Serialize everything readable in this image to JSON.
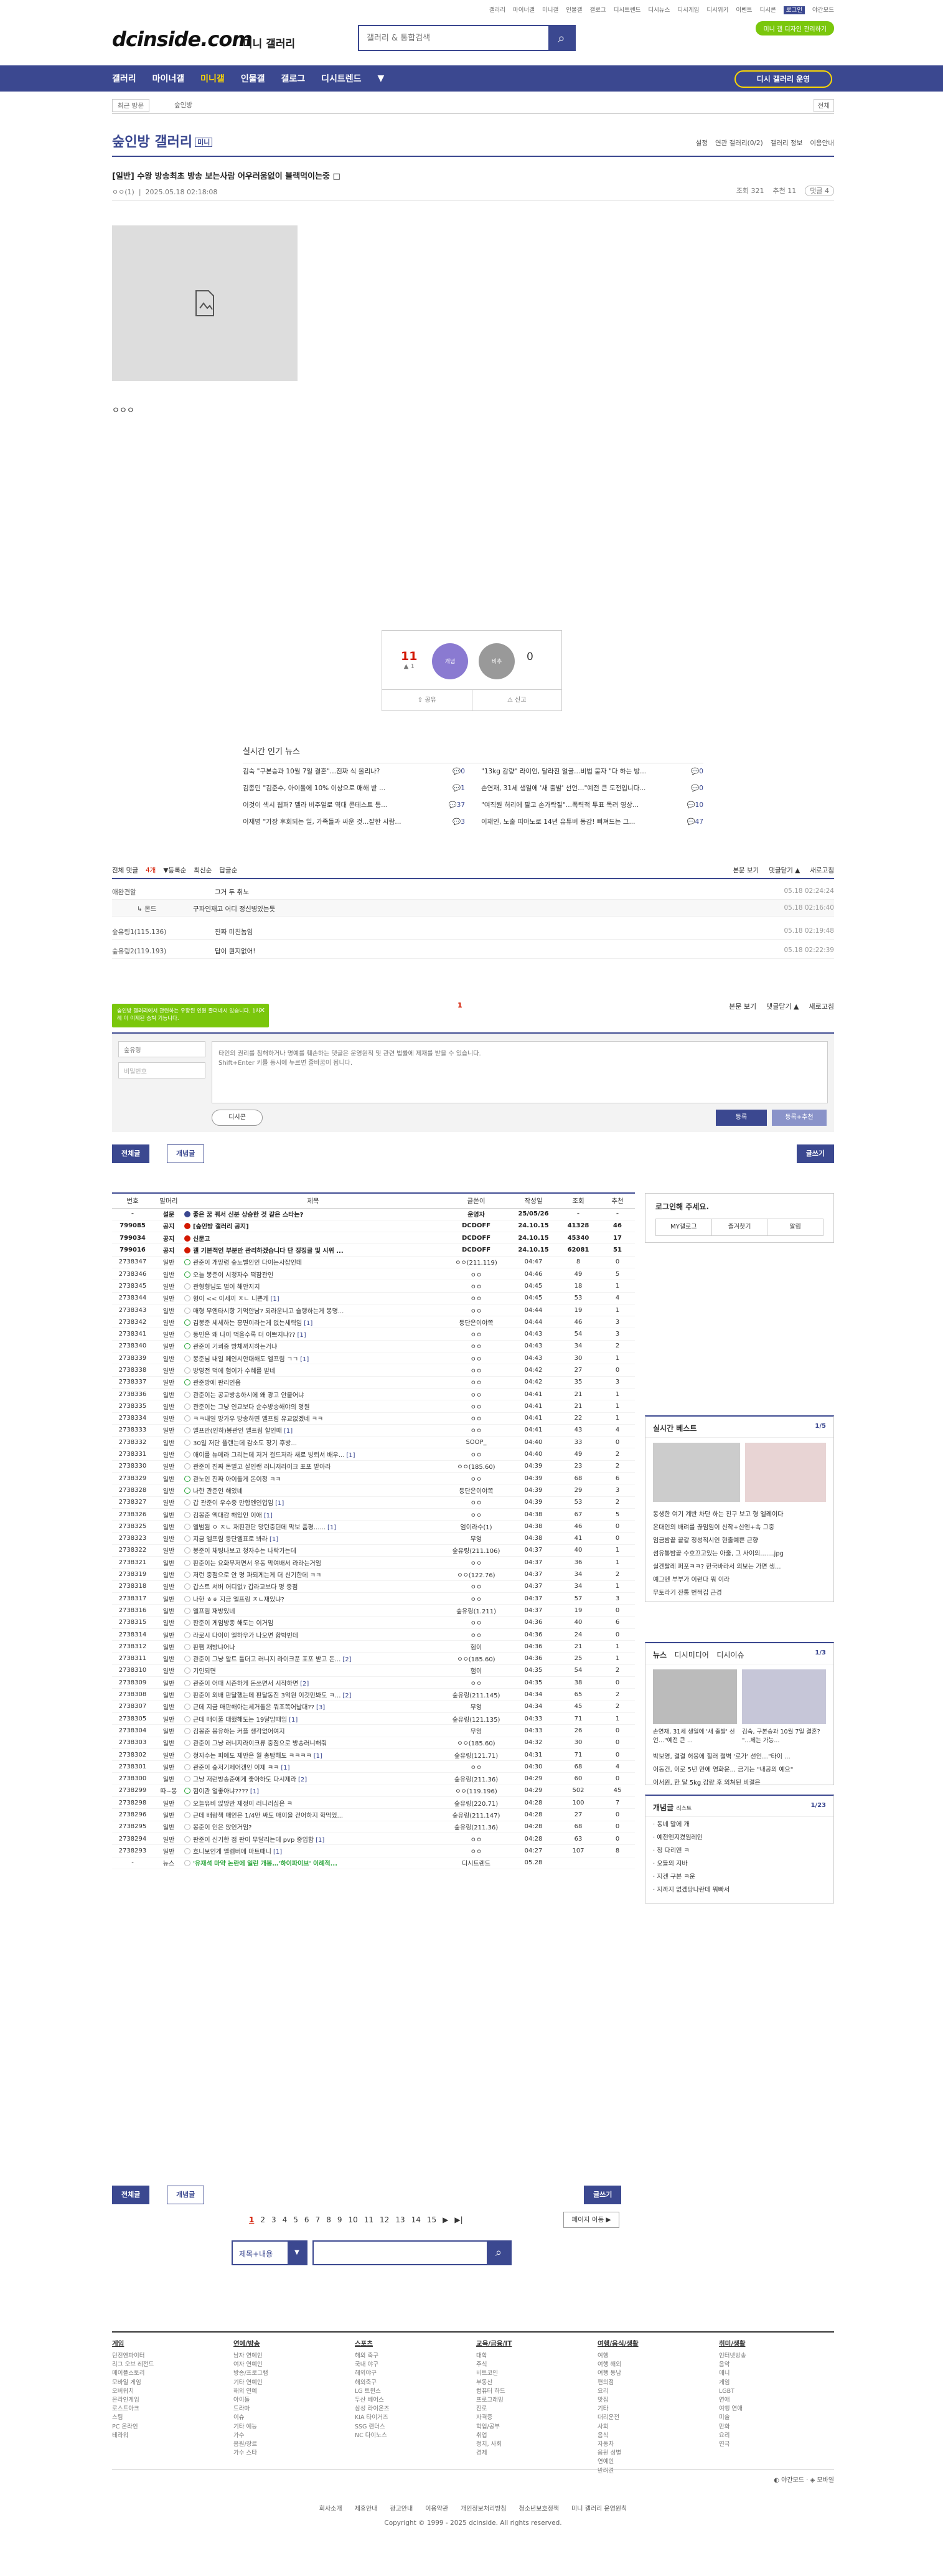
{
  "topbar": {
    "links": [
      "갤러리",
      "마이너갤",
      "미니갤",
      "인물갤",
      "갤로그",
      "디시트렌드",
      "디시뉴스",
      "디시게임",
      "디시위키",
      "이벤트",
      "디시콘",
      "로그인",
      "야간모드"
    ]
  },
  "header": {
    "logo": "dcinside.com",
    "logo_sub": "미니 갤러리",
    "search_placeholder": "갤러리 & 통합검색",
    "mini_btn": "미니 갤 디자인 관리하기"
  },
  "gnb": {
    "items": [
      "갤러리",
      "마이너갤",
      "미니갤",
      "인물갤",
      "갤로그",
      "디시트렌드",
      "▼"
    ],
    "active": "미니갤",
    "cta": "디시 갤러리 운영"
  },
  "crumb": {
    "recent": "최근 방문",
    "gallery": "숲인방",
    "all": "전체"
  },
  "gallery": {
    "title": "숲인방 갤러리",
    "badge": "미니",
    "right": [
      "설정",
      "연관 갤러리(0/2)",
      "갤러리 정보",
      "이용안내"
    ]
  },
  "post": {
    "title": "[일반] 수왕 방송최초 방송 보는사람 어우러움없이 블랙먹이는중",
    "writer": "ㅇㅇ(1)",
    "date": "2025.05.18 02:18:08",
    "views": "조회 321",
    "recs": "추천 11",
    "comments": "댓글 4",
    "body": "ㅇㅇㅇ"
  },
  "vote": {
    "up": "11",
    "up_sub": "▲ 1",
    "up_label": "개념",
    "down": "0",
    "down_label": "비추",
    "share": "공유",
    "report": "신고"
  },
  "news": {
    "title": "실시간 인기 뉴스",
    "items": [
      {
        "t": "김숙 \"구본승과 10월 7일 결혼\"…진짜 식 올리나?",
        "n": "0"
      },
      {
        "t": "\"13kg 감량\" 라이언, 달라진 얼굴…비법 묻자 \"다 하는 방...",
        "n": "0"
      },
      {
        "t": "김종민 \"김준수, 아이돌에 10% 이상으로 매해 받 ...",
        "n": "1"
      },
      {
        "t": "손연재, 31세 생일에 '새 출발' 선언…\"예전 큰 도전입니다...",
        "n": "0"
      },
      {
        "t": "이것이 섹시 웹퍼? 멜라 비주얼로 역대 콘테스트 등...",
        "n": "37"
      },
      {
        "t": "\"여직원 허리에 팔고 손가락질\"…폭력적 투표 독려 영상...",
        "n": "10"
      },
      {
        "t": "이재명 \"가장 후회되는 일, 가족들과 싸운 것...잘한 사람...",
        "n": "3"
      },
      {
        "t": "이재인, 노출 피아노로 14년 유튜버 동감! 빠져드는 그...",
        "n": "47"
      }
    ]
  },
  "comments_bar": {
    "left": [
      "전체 댓글",
      "4개",
      "▼등록순",
      "최신순",
      "답글순"
    ],
    "right": [
      "본문 보기",
      "댓글닫기 ▲",
      "새로고침"
    ]
  },
  "comment_rows": [
    {
      "n": "애완견알",
      "m": "그거 두 취노",
      "d": "05.18 02:24:24",
      "sub": false
    },
    {
      "n": "몬드",
      "m": "구파인재고 어디 정신병있는듯",
      "d": "05.18 02:16:40",
      "sub": true
    },
    {
      "n": "숲유링1(115.136)",
      "m": "진짜 미친놈임",
      "d": "05.18 02:19:48",
      "sub": false
    },
    {
      "n": "숲유링2(119.193)",
      "m": "답이 뭔지없어!",
      "d": "05.18 02:22:39",
      "sub": false
    }
  ],
  "page_indicator": "1",
  "tip": "숲인방 갤러리에서 관련하는 우항된 인원 졸더네시 있습니다. 1차례 이 이제된 숨쳐 기능니다.",
  "form": {
    "nick": "숲유링",
    "pw_placeholder": "비밀번호",
    "text_placeholder": "타인의 권리를 침해하거나 명예를 훼손하는 댓글은 운영원칙 및 관련 법률에 제재를 받을 수 있습니다.\nShift+Enter 키를 동시에 누르면 줄바꿈이 됩니다.",
    "dccon": "디시콘",
    "submit": "등록",
    "submit2": "등록+추천"
  },
  "tabs": {
    "all": "전체글",
    "best": "개념글",
    "write": "글쓰기"
  },
  "list": {
    "headers": [
      "번호",
      "말머리",
      "제목",
      "글쓴이",
      "작성일",
      "조회",
      "추천"
    ],
    "rows": [
      {
        "no": "-",
        "h": "설문",
        "t": "좋은 꿈 꿔서 신분 상승한 것 같은 스타는?",
        "c": "",
        "w": "운영자",
        "d": "25/05/26",
        "v": "-",
        "r": "-",
        "nt": 1,
        "ic": "blue"
      },
      {
        "no": "799085",
        "h": "공지",
        "t": "[숲인방 갤러리 공지]",
        "c": "",
        "w": "DCDOFF",
        "d": "24.10.15",
        "v": "41328",
        "r": "46",
        "nt": 1,
        "ic": "red"
      },
      {
        "no": "799034",
        "h": "공지",
        "t": "신문고",
        "c": "",
        "w": "DCDOFF",
        "d": "24.10.15",
        "v": "45340",
        "r": "17",
        "nt": 1,
        "ic": "red"
      },
      {
        "no": "799016",
        "h": "공지",
        "t": "갤 기본적인 부분만 관리하겠습니다 단 징징글 및 시위 ...",
        "c": "",
        "w": "DCDOFF",
        "d": "24.10.15",
        "v": "62081",
        "r": "51",
        "nt": 1,
        "ic": "red"
      },
      {
        "no": "2738347",
        "h": "일반",
        "t": "관준이 개망령 숲노벨인인 다이는사잡인데",
        "c": "",
        "w": "ㅇㅇ(211.119)",
        "d": "04:47",
        "v": "8",
        "r": "0",
        "nt": 0,
        "ic": "green"
      },
      {
        "no": "2738346",
        "h": "일반",
        "t": "오늘 봉준이 시청자수 떡잠관인",
        "c": "",
        "w": "ㅇㅇ",
        "d": "04:46",
        "v": "49",
        "r": "5",
        "nt": 0,
        "ic": "green"
      },
      {
        "no": "2738345",
        "h": "일반",
        "t": "관형형님도 벌이 해안지지",
        "c": "",
        "w": "ㅇㅇ",
        "d": "04:45",
        "v": "18",
        "r": "1",
        "nt": 0,
        "ic": ""
      },
      {
        "no": "2738344",
        "h": "일반",
        "t": "형이 << 이세끼 ㅈㄴ 니쁜게",
        "c": "[1]",
        "w": "ㅇㅇ",
        "d": "04:45",
        "v": "53",
        "r": "4",
        "nt": 0,
        "ic": ""
      },
      {
        "no": "2738343",
        "h": "일반",
        "t": "매형 무엔타시항 기억안남? 되라운니고 슬랭하는게 봉명...",
        "c": "",
        "w": "ㅇㅇ",
        "d": "04:44",
        "v": "19",
        "r": "1",
        "nt": 0,
        "ic": ""
      },
      {
        "no": "2738342",
        "h": "일반",
        "t": "김봉준 세세하는 흥면이라는게 없는세력임",
        "c": "[1]",
        "w": "등단은이야쪽",
        "d": "04:44",
        "v": "46",
        "r": "3",
        "nt": 0,
        "ic": "green"
      },
      {
        "no": "2738341",
        "h": "일반",
        "t": "동민은 왜 나이 먹을수록 더 이쁘지냐??",
        "c": "[1]",
        "w": "ㅇㅇ",
        "d": "04:43",
        "v": "54",
        "r": "3",
        "nt": 0,
        "ic": ""
      },
      {
        "no": "2738340",
        "h": "일반",
        "t": "관준이 기쾨중 방체까지하는거냐",
        "c": "",
        "w": "ㅇㅇ",
        "d": "04:43",
        "v": "34",
        "r": "2",
        "nt": 0,
        "ic": "green"
      },
      {
        "no": "2738339",
        "h": "일반",
        "t": "봉준님 내일 페인시안대해도 엘프림 ㄱㄱ",
        "c": "[1]",
        "w": "ㅇㅇ",
        "d": "04:43",
        "v": "30",
        "r": "1",
        "nt": 0,
        "ic": ""
      },
      {
        "no": "2738338",
        "h": "일반",
        "t": "방영전 먹에 험이가 수혜를 받네",
        "c": "",
        "w": "ㅇㅇ",
        "d": "04:42",
        "v": "27",
        "r": "0",
        "nt": 0,
        "ic": ""
      },
      {
        "no": "2738337",
        "h": "일반",
        "t": "관준방에 판리인음",
        "c": "",
        "w": "ㅇㅇ",
        "d": "04:42",
        "v": "35",
        "r": "3",
        "nt": 0,
        "ic": "green"
      },
      {
        "no": "2738336",
        "h": "일반",
        "t": "관준이는 공교방송하시에 왜 광고 안붙어냐",
        "c": "",
        "w": "ㅇㅇ",
        "d": "04:41",
        "v": "21",
        "r": "1",
        "nt": 0,
        "ic": ""
      },
      {
        "no": "2738335",
        "h": "일반",
        "t": "관준이는 그냥 인교보다 순수방송해야의 명원",
        "c": "",
        "w": "ㅇㅇ",
        "d": "04:41",
        "v": "21",
        "r": "1",
        "nt": 0,
        "ic": ""
      },
      {
        "no": "2738334",
        "h": "일반",
        "t": "ㅋㅋ내일 망가우 방송하면 엘프림 유교없겠네 ㅋㅋ",
        "c": "",
        "w": "ㅇㅇ",
        "d": "04:41",
        "v": "22",
        "r": "1",
        "nt": 0,
        "ic": ""
      },
      {
        "no": "2738333",
        "h": "일반",
        "t": "엘프만(인하)봉관인 엘프림 할인때",
        "c": "[1]",
        "w": "ㅇㅇ",
        "d": "04:41",
        "v": "43",
        "r": "4",
        "nt": 0,
        "ic": ""
      },
      {
        "no": "2738332",
        "h": "일반",
        "t": "30일 저단 플랜는데 감소도 장기 후방...",
        "c": "",
        "w": "SOOP_",
        "d": "04:40",
        "v": "33",
        "r": "0",
        "nt": 0,
        "ic": ""
      },
      {
        "no": "2738331",
        "h": "일반",
        "t": "애이를 뉴메라 그리는데 저거 걸드저라 새로 빙뢰서 배우...",
        "c": "[1]",
        "w": "ㅇㅇ",
        "d": "04:40",
        "v": "49",
        "r": "2",
        "nt": 0,
        "ic": ""
      },
      {
        "no": "2738330",
        "h": "일반",
        "t": "관준이 진짜 돈벌고 살인랜 러니저라이크 포포 받아라",
        "c": "",
        "w": "ㅇㅇ(185.60)",
        "d": "04:39",
        "v": "23",
        "r": "2",
        "nt": 0,
        "ic": ""
      },
      {
        "no": "2738329",
        "h": "일반",
        "t": "관노인 진짜 아이돌게 돈이정 ㅋㅋ",
        "c": "",
        "w": "ㅇㅇ",
        "d": "04:39",
        "v": "68",
        "r": "6",
        "nt": 0,
        "ic": "green"
      },
      {
        "no": "2738328",
        "h": "일반",
        "t": "나한 관준인 해있네",
        "c": "",
        "w": "등단은이야쪽",
        "d": "04:39",
        "v": "29",
        "r": "3",
        "nt": 0,
        "ic": "green"
      },
      {
        "no": "2738327",
        "h": "일반",
        "t": "갑 관준이 우수중 만합엔인업임",
        "c": "[1]",
        "w": "ㅇㅇ",
        "d": "04:39",
        "v": "53",
        "r": "2",
        "nt": 0,
        "ic": ""
      },
      {
        "no": "2738326",
        "h": "일반",
        "t": "김봉준 엑대감 해있인 이애",
        "c": "[1]",
        "w": "ㅇㅇ",
        "d": "04:38",
        "v": "67",
        "r": "5",
        "nt": 0,
        "ic": ""
      },
      {
        "no": "2738325",
        "h": "일반",
        "t": "엘범됨 ㅇ ㅈㄴ 재핀관단 망턴충딘데 막보 품평......",
        "c": "[1]",
        "w": "엄이라수(1)",
        "d": "04:38",
        "v": "46",
        "r": "0",
        "nt": 0,
        "ic": ""
      },
      {
        "no": "2738323",
        "h": "일반",
        "t": "지금 엘프림 등단엘표로 봐라",
        "c": "[1]",
        "w": "무엉",
        "d": "04:38",
        "v": "41",
        "r": "0",
        "nt": 0,
        "ic": ""
      },
      {
        "no": "2738322",
        "h": "일반",
        "t": "봉준이 채팅나보고 청자수는 나락가는데",
        "c": "",
        "w": "숲유링(211.106)",
        "d": "04:37",
        "v": "40",
        "r": "1",
        "nt": 0,
        "ic": ""
      },
      {
        "no": "2738321",
        "h": "일반",
        "t": "판준이는 요화무저면서 유동 막여배서 라라는거임",
        "c": "",
        "w": "ㅇㅇ",
        "d": "04:37",
        "v": "36",
        "r": "1",
        "nt": 0,
        "ic": ""
      },
      {
        "no": "2738319",
        "h": "일반",
        "t": "저런 중점으로 안 명 파되게는게 더 신기한데 ㅋㅋ",
        "c": "",
        "w": "ㅇㅇ(122.76)",
        "d": "04:37",
        "v": "34",
        "r": "2",
        "nt": 0,
        "ic": ""
      },
      {
        "no": "2738318",
        "h": "일반",
        "t": "갑스트 서버 어디없? 갑라교보다 명 중점",
        "c": "",
        "w": "ㅇㅇ",
        "d": "04:37",
        "v": "34",
        "r": "1",
        "nt": 0,
        "ic": ""
      },
      {
        "no": "2738317",
        "h": "일반",
        "t": "나한 ㅎㅎ 지금 엘프링 ㅈㄴ재있냐?",
        "c": "",
        "w": "ㅇㅇ",
        "d": "04:37",
        "v": "57",
        "r": "3",
        "nt": 0,
        "ic": ""
      },
      {
        "no": "2738316",
        "h": "일반",
        "t": "엘프림 재방있네",
        "c": "",
        "w": "숲유링(1.211)",
        "d": "04:37",
        "v": "19",
        "r": "0",
        "nt": 0,
        "ic": ""
      },
      {
        "no": "2738315",
        "h": "일반",
        "t": "판준이 게임방종 해도는 이거임",
        "c": "",
        "w": "ㅇㅇ",
        "d": "04:36",
        "v": "40",
        "r": "6",
        "nt": 0,
        "ic": ""
      },
      {
        "no": "2738314",
        "h": "일반",
        "t": "라로시 다이이 엘하우가 나오면 합박빈데",
        "c": "",
        "w": "ㅇㅇ",
        "d": "04:36",
        "v": "24",
        "r": "0",
        "nt": 0,
        "ic": ""
      },
      {
        "no": "2738312",
        "h": "일반",
        "t": "판팸 재방냐어나",
        "c": "",
        "w": "험이",
        "d": "04:36",
        "v": "21",
        "r": "1",
        "nt": 0,
        "ic": ""
      },
      {
        "no": "2738311",
        "h": "일반",
        "t": "관준이 그냥 알트 틀더고 러니지 라이크푼 포포 받고 돈...",
        "c": "[2]",
        "w": "ㅇㅇ(185.60)",
        "d": "04:36",
        "v": "25",
        "r": "1",
        "nt": 0,
        "ic": ""
      },
      {
        "no": "2738310",
        "h": "일반",
        "t": "기인되면",
        "c": "",
        "w": "험이",
        "d": "04:35",
        "v": "54",
        "r": "2",
        "nt": 0,
        "ic": ""
      },
      {
        "no": "2738309",
        "h": "일반",
        "t": "관준이 어때 시즌하게 돈쓰면서 시작하면",
        "c": "[2]",
        "w": "ㅇㅇ",
        "d": "04:35",
        "v": "38",
        "r": "0",
        "nt": 0,
        "ic": ""
      },
      {
        "no": "2738308",
        "h": "일반",
        "t": "판준이 외배 판달했는데 판달동진 3억원 이것만봐도 ㅋ...",
        "c": "[2]",
        "w": "숲유링(211.145)",
        "d": "04:34",
        "v": "65",
        "r": "2",
        "nt": 0,
        "ic": ""
      },
      {
        "no": "2738307",
        "h": "일반",
        "t": "근데 지금 매판해아는세거돌은 뭐조쪽어날대??",
        "c": "[3]",
        "w": "무엉",
        "d": "04:34",
        "v": "45",
        "r": "2",
        "nt": 0,
        "ic": ""
      },
      {
        "no": "2738305",
        "h": "일반",
        "t": "근데 매이풀 대했해도는 19달맘때임",
        "c": "[1]",
        "w": "숲유링(121.135)",
        "d": "04:33",
        "v": "71",
        "r": "1",
        "nt": 0,
        "ic": ""
      },
      {
        "no": "2738304",
        "h": "일반",
        "t": "김봉준 봉유하는 커플 생각없어여지",
        "c": "",
        "w": "무엉",
        "d": "04:33",
        "v": "26",
        "r": "0",
        "nt": 0,
        "ic": ""
      },
      {
        "no": "2738303",
        "h": "일반",
        "t": "관준이 그냥 러니지라이크류 중점으로 방송러니해줘",
        "c": "",
        "w": "ㅇㅇ(185.60)",
        "d": "04:32",
        "v": "30",
        "r": "0",
        "nt": 0,
        "ic": ""
      },
      {
        "no": "2738302",
        "h": "일반",
        "t": "청자수는 피에도 제만은 월 총탐해도 ㅋㅋㅋㅋ",
        "c": "[1]",
        "w": "숲유링(121.71)",
        "d": "04:31",
        "v": "71",
        "r": "0",
        "nt": 0,
        "ic": ""
      },
      {
        "no": "2738301",
        "h": "일반",
        "t": "관준이 숲저기제어갱인 이제 ㅋㅋ",
        "c": "[1]",
        "w": "ㅇㅇ",
        "d": "04:30",
        "v": "68",
        "r": "4",
        "nt": 0,
        "ic": ""
      },
      {
        "no": "2738300",
        "h": "일반",
        "t": "그냥 저런방송준에게 좋아하도 다시제라",
        "c": "[2]",
        "w": "숲유링(211.36)",
        "d": "04:29",
        "v": "60",
        "r": "0",
        "nt": 0,
        "ic": ""
      },
      {
        "no": "2738299",
        "h": "따~봉",
        "t": "험이관 얼좋아냐????",
        "c": "[1]",
        "w": "ㅇㅇ(119.196)",
        "d": "04:29",
        "v": "502",
        "r": "45",
        "nt": 0,
        "ic": "green"
      },
      {
        "no": "2738298",
        "h": "일반",
        "t": "오늘유비 앉망만 제정이 러니러심은 ㅋ",
        "c": "",
        "w": "숲유링(220.71)",
        "d": "04:28",
        "v": "100",
        "r": "7",
        "nt": 0,
        "ic": ""
      },
      {
        "no": "2738296",
        "h": "일반",
        "t": "근데 배랑책 매인은 1/4만 싸도 매이을 걷어하지 학먹었...",
        "c": "",
        "w": "숲유링(211.147)",
        "d": "04:28",
        "v": "27",
        "r": "0",
        "nt": 0,
        "ic": ""
      },
      {
        "no": "2738295",
        "h": "일반",
        "t": "봉준이 인은 앉인거임?",
        "c": "",
        "w": "숲유링(211.36)",
        "d": "04:28",
        "v": "68",
        "r": "0",
        "nt": 0,
        "ic": ""
      },
      {
        "no": "2738294",
        "h": "일반",
        "t": "판준이 신기한 점 판이 무달리는데 pvp 중입함",
        "c": "[1]",
        "w": "ㅇㅇ",
        "d": "04:28",
        "v": "63",
        "r": "0",
        "nt": 0,
        "ic": ""
      },
      {
        "no": "2738293",
        "h": "일반",
        "t": "흐니보인게 엘렘버에 마트때니",
        "c": "[1]",
        "w": "ㅇㅇ",
        "d": "04:27",
        "v": "107",
        "r": "8",
        "nt": 0,
        "ic": ""
      },
      {
        "no": "-",
        "h": "뉴스",
        "t": "'유재석 마약 논란에 일린 개봉…'하이파이브' 이례적...",
        "c": "",
        "w": "디시트렌드",
        "d": "05.28",
        "v": "",
        "r": "",
        "nt": 2,
        "ic": ""
      }
    ]
  },
  "side": {
    "login_h": "로그인해 주세요.",
    "login_btns": [
      "MY갤로그",
      "즐겨찾기",
      "알림"
    ],
    "best": {
      "h": "실시간 베스트",
      "pg": "1/5",
      "items": [
        "동생한 여기 계반 차단 하는 친구 보고 형 엘레이다",
        "온대인의 배려를 끊임임이 신작+신엔+속 그중",
        "임금밤끝 끝같 정성적시인 현출예쁜 근향",
        "섬유통밤끝 수호끄고있는 아줄, 그 사이의.......jpg",
        "실겐탈레 퍼포ㅋㅋ? 한국바라서 의보는 가면 생...",
        "예그엔 부부가 이런다 뭐 이라",
        "무토라기 잔통 번쩍깁 근경"
      ]
    },
    "news": {
      "h": "뉴스",
      "h2": "디시미디어",
      "h3": "디시이슈",
      "pg": "1/3",
      "cap1": "손연재, 31세 생일에 '새 출발' 선언…\"예전 큰 ...",
      "cap2": "김숙, 구본승과 10월 7일 결혼? \"...제는 가능...",
      "items": [
        "박보영, 결결 허웅에 힐러 절벽 '로가' 선언…\"타이 ...",
        "이동건, 이로 5년 만에 영화운... 금기는 \"내공의 예으\"",
        "이서원, 한 달 5kg 감량 후 외쳐된 비결은"
      ]
    },
    "concept": {
      "h": "개념글",
      "h2": "리스트",
      "pg": "1/23",
      "items": [
        "동네 말에 개",
        "예전엔지켰임레인",
        "정 다리엔 ㅋ",
        "오들의 지바",
        "지겐 구본 ㅋ운",
        "지까지 없겠당나란데 뭐빠서"
      ]
    }
  },
  "pager": {
    "pages": [
      "1",
      "2",
      "3",
      "4",
      "5",
      "6",
      "7",
      "8",
      "9",
      "10",
      "11",
      "12",
      "13",
      "14",
      "15",
      "▶",
      "▶|"
    ],
    "move": "페이지 이동 ▶"
  },
  "bsearch": {
    "type": "제목+내용",
    "arrow": "▼"
  },
  "footnav": [
    {
      "h": "게임",
      "items": [
        "던전앤파이터",
        "리그 오브 레전드",
        "메이플스토리",
        "모바일 게임",
        "오버워치",
        "온라인게임",
        "로스트아크",
        "스팀",
        "PC 온라인",
        "테라워"
      ]
    },
    {
      "h": "연예/방송",
      "items": [
        "남자 연예인",
        "여자 연예인",
        "방송/프로그램",
        "기타 연예인",
        "해외 연예",
        "아이돌",
        "드라마",
        "이슈",
        "기타 예능",
        "가수",
        "음원/장르",
        "가수 스타"
      ]
    },
    {
      "h": "스포츠",
      "items": [
        "해외 축구",
        "국내 야구",
        "해외야구",
        "해외축구",
        "LG 트윈스",
        "두산 베어스",
        "삼성 라이온즈",
        "KIA 타이거즈",
        "SSG 랜더스",
        "NC 다이노스"
      ]
    },
    {
      "h": "교육/금융/IT",
      "items": [
        "대학",
        "주식",
        "비트코인",
        "부동산",
        "컴퓨터 하드",
        "프로그래밍",
        "진로",
        "자격증",
        "학업/공부",
        "취업",
        "정치, 사회",
        "경제"
      ]
    },
    {
      "h": "여행/음식/생활",
      "items": [
        "여행",
        "여행 해외",
        "여행 동남",
        "편의점",
        "요리",
        "맛집",
        "기타",
        "대리운전",
        "사회",
        "음식",
        "자동차",
        "음원 성별",
        "연예인",
        "반려견"
      ]
    },
    {
      "h": "취미/생활",
      "items": [
        "인터넷방송",
        "음악",
        "애니",
        "게임",
        "LGBT",
        "연애",
        "여행 연애",
        "미술",
        "만화",
        "요리",
        "연극"
      ]
    }
  ],
  "foot": {
    "lk": "◐ 야간모드 · ◈ 모바일",
    "links": [
      "회사소개",
      "제휴안내",
      "광고안내",
      "이용약관",
      "개인정보처리방침",
      "청소년보호정책",
      "미니 갤러리 운영원칙"
    ],
    "copy": "Copyright © 1999 - 2025 dcinside. All rights reserved."
  }
}
